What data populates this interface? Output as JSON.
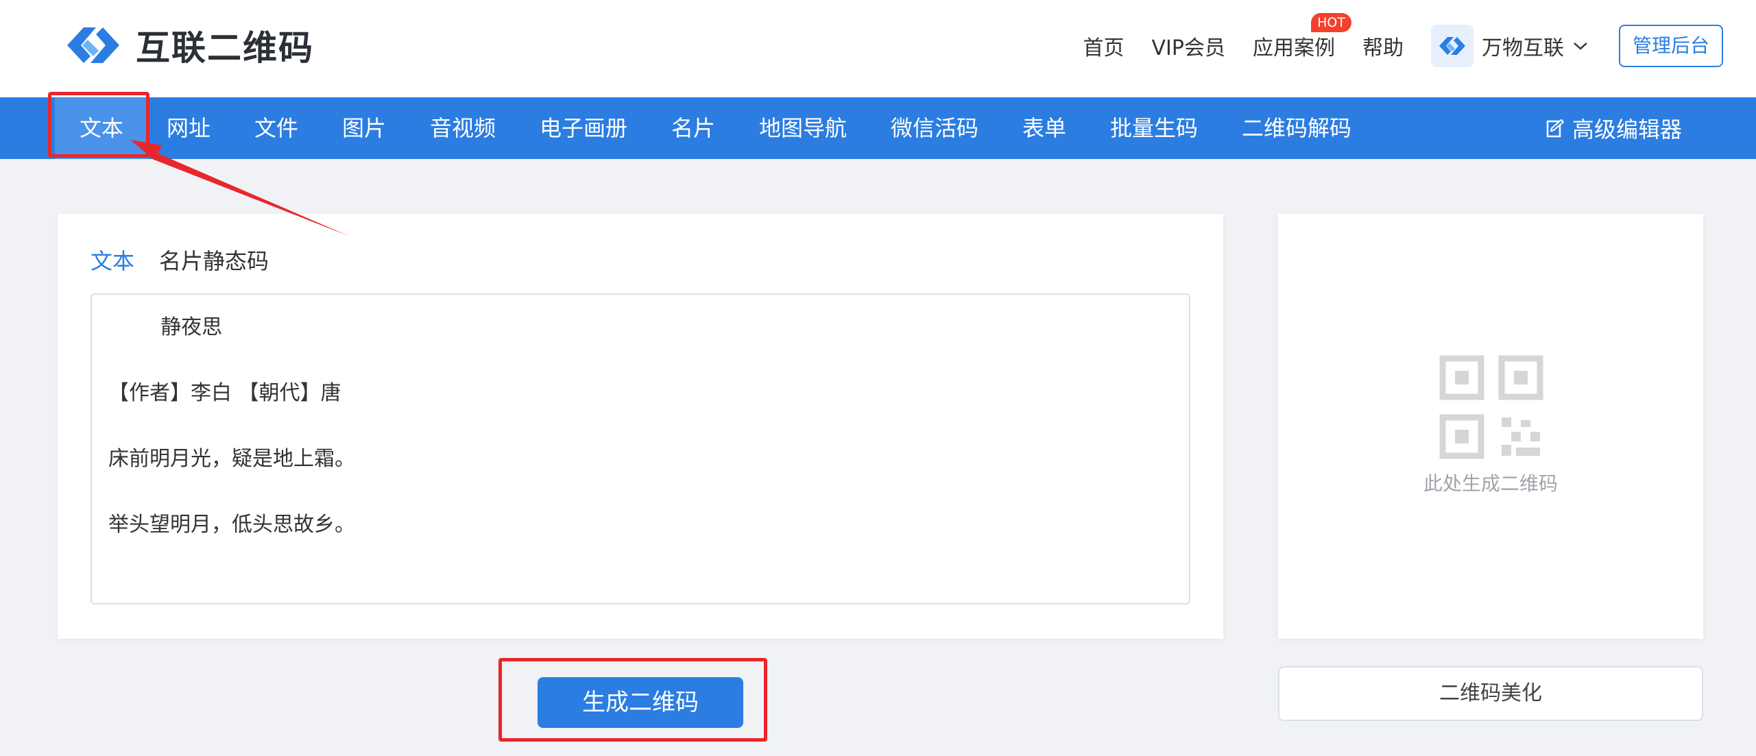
{
  "header": {
    "logo_text": "互联二维码",
    "nav": [
      "首页",
      "VIP会员",
      "应用案例",
      "帮助"
    ],
    "hot_badge": "HOT",
    "brand_name": "万物互联",
    "admin_label": "管理后台"
  },
  "navbar": {
    "tabs": [
      "文本",
      "网址",
      "文件",
      "图片",
      "音视频",
      "电子画册",
      "名片",
      "地图导航",
      "微信活码",
      "表单",
      "批量生码",
      "二维码解码"
    ],
    "advanced_editor": "高级编辑器"
  },
  "editor": {
    "sub_tabs": [
      "文本",
      "名片静态码"
    ],
    "lines": [
      "        静夜思",
      "【作者】李白 【朝代】唐",
      "床前明月光，疑是地上霜。",
      "举头望明月，低头思故乡。"
    ]
  },
  "generate_label": "生成二维码",
  "preview": {
    "caption": "此处生成二维码",
    "beautify_label": "二维码美化"
  },
  "colors": {
    "primary": "#2b7de1",
    "annotation": "#e8262b",
    "hot": "#f5402c"
  }
}
